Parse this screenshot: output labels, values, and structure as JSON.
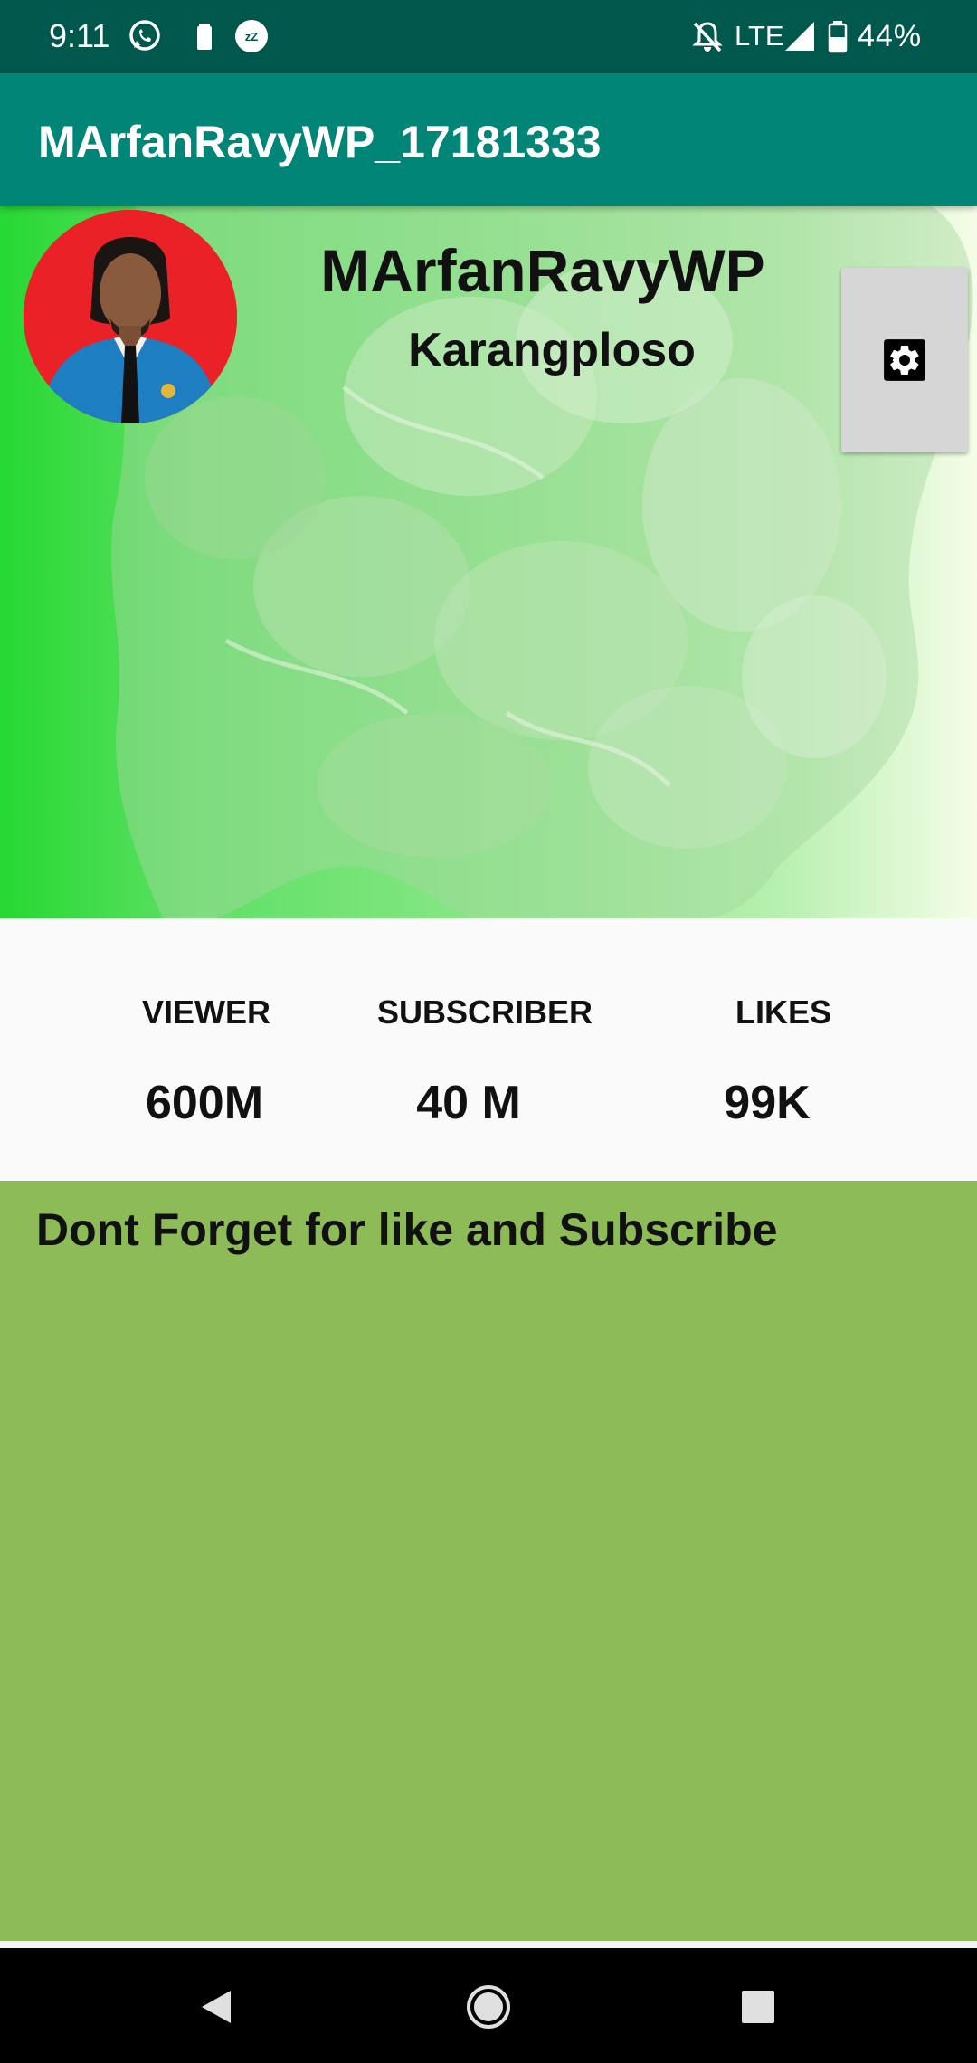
{
  "status_bar": {
    "time": "9:11",
    "network": "LTE",
    "battery_percent": "44%",
    "icons": [
      "whatsapp-icon",
      "battery-saver-icon",
      "sleep-icon",
      "mute-icon",
      "signal-icon",
      "battery-icon"
    ]
  },
  "app_bar": {
    "title": "MArfanRavyWP_17181333"
  },
  "profile": {
    "name": "MArfanRavyWP",
    "location": "Karangploso",
    "avatar_icon": "avatar",
    "settings_icon": "gear-icon"
  },
  "stats": [
    {
      "label": "VIEWER",
      "value": "600M"
    },
    {
      "label": "SUBSCRIBER",
      "value": "40 M"
    },
    {
      "label": "LIKES",
      "value": "99K"
    }
  ],
  "message": "Dont Forget for like and Subscribe",
  "colors": {
    "status_bar": "#00574b",
    "app_bar": "#008577",
    "message_panel": "#8cbb57",
    "stats_background": "#fafafa",
    "settings_button": "#d6d6d6"
  },
  "nav_bar": {
    "buttons": [
      "back-icon",
      "home-icon",
      "recents-icon"
    ]
  }
}
